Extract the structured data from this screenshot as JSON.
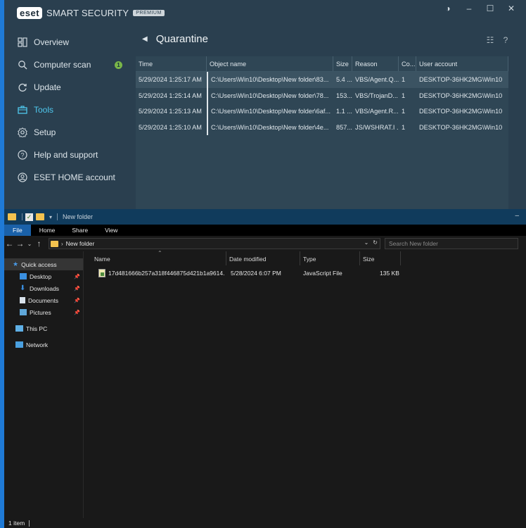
{
  "eset": {
    "logo": "eset",
    "brand": "SMART SECURITY",
    "edition": "PREMIUM",
    "window_buttons": {
      "theme": "◑",
      "minimize": "–",
      "maximize": "☐",
      "close": "✕"
    },
    "nav": [
      {
        "label": "Overview",
        "icon": "overview-icon"
      },
      {
        "label": "Computer scan",
        "icon": "magnifier-icon",
        "badge": "1"
      },
      {
        "label": "Update",
        "icon": "refresh-icon"
      },
      {
        "label": "Tools",
        "icon": "briefcase-icon",
        "active": true
      },
      {
        "label": "Setup",
        "icon": "gear-icon"
      },
      {
        "label": "Help and support",
        "icon": "help-icon"
      },
      {
        "label": "ESET HOME account",
        "icon": "user-icon"
      }
    ],
    "page_title": "Quarantine",
    "tools": {
      "list": "☷",
      "help": "?"
    },
    "table": {
      "headers": [
        "Time",
        "Object name",
        "Size",
        "Reason",
        "Co...",
        "User account"
      ],
      "rows": [
        [
          "5/29/2024 1:25:17 AM",
          "C:\\Users\\Win10\\Desktop\\New folder\\83...",
          "5.4 ...",
          "VBS/Agent.Q...",
          "1",
          "DESKTOP-36HK2MG\\Win10"
        ],
        [
          "5/29/2024 1:25:14 AM",
          "C:\\Users\\Win10\\Desktop\\New folder\\78...",
          "153...",
          "VBS/TrojanD...",
          "1",
          "DESKTOP-36HK2MG\\Win10"
        ],
        [
          "5/29/2024 1:25:13 AM",
          "C:\\Users\\Win10\\Desktop\\New folder\\6af...",
          "1.1 ...",
          "VBS/Agent.R...",
          "1",
          "DESKTOP-36HK2MG\\Win10"
        ],
        [
          "5/29/2024 1:25:10 AM",
          "C:\\Users\\Win10\\Desktop\\New folder\\4e...",
          "857...",
          "JS/WSHRAT.I ...",
          "1",
          "DESKTOP-36HK2MG\\Win10"
        ]
      ]
    }
  },
  "explorer": {
    "title": "New folder",
    "minimize": "–",
    "ribbon_tabs": [
      "File",
      "Home",
      "Share",
      "View"
    ],
    "address": {
      "path": "New folder",
      "search_placeholder": "Search New folder"
    },
    "nav": {
      "quick_access": "Quick access",
      "items": [
        {
          "label": "Desktop"
        },
        {
          "label": "Downloads"
        },
        {
          "label": "Documents"
        },
        {
          "label": "Pictures"
        }
      ],
      "this_pc": "This PC",
      "network": "Network"
    },
    "columns": [
      "Name",
      "Date modified",
      "Type",
      "Size"
    ],
    "files": [
      {
        "name": "17d481666b257a318f446875d421b1a9614...",
        "modified": "5/28/2024 6:07 PM",
        "type": "JavaScript File",
        "size": "135 KB"
      }
    ],
    "status": "1 item"
  }
}
